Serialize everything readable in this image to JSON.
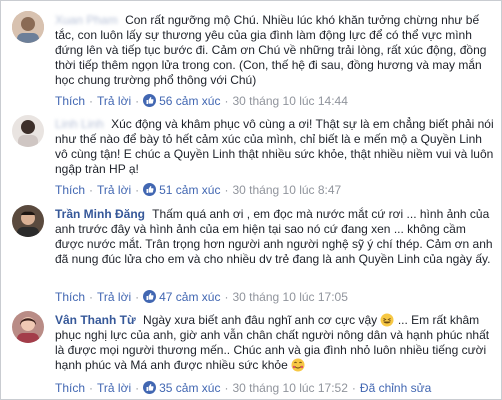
{
  "comments": [
    {
      "author": "Xuan Pham",
      "author_blurred": true,
      "text": "Con rất ngưỡng mộ Chú. Nhiều lúc khó khăn tưởng chừng như bế tắc, con luôn lấy sự thương yêu của gia đình làm động lực để có thể vực mình đứng lên và tiếp tục bước đi. Cảm ơn Chú về những trải lòng, rất xúc động, đồng thời tiếp thêm ngọn lửa trong con. (Con, thế hệ đi sau, đồng hương và may mắn học chung trường phổ thông với Chú)",
      "like_label": "Thích",
      "reply_label": "Trả lời",
      "reactions": "56 cảm xúc",
      "timestamp": "30 tháng 10 lúc 14:44",
      "edited_label": ""
    },
    {
      "author": "Linh Linh",
      "author_blurred": true,
      "text": "Xúc động và khâm phục vô cùng a ơi! Thật sự là em chẳng biết phải nói như thế nào để bày tỏ hết cảm xúc của mình, chỉ biết là e mến mộ a Quyền Linh vô cùng tận! E chúc a Quyền Linh thật nhiều sức khỏe, thật nhiều niềm vui và luôn ngập tràn HP ạ!",
      "like_label": "Thích",
      "reply_label": "Trả lời",
      "reactions": "51 cảm xúc",
      "timestamp": "30 tháng 10 lúc 8:47",
      "edited_label": ""
    },
    {
      "author": "Trần Minh Đăng",
      "author_blurred": false,
      "text": "Thấm quá anh ơi , em đọc mà nước mắt cứ rơi ... hình ảnh của anh trước đây và hình ảnh của em hiện tại sao nó cứ đang xen ... không cầm được nước mắt. Trân trọng hơn người anh người nghệ sỹ ý chí thép. Cảm ơn anh đã nung đúc lửa cho em và cho nhiều dv trẻ đang là anh Quyền Linh của ngày ấy.",
      "like_label": "Thích",
      "reply_label": "Trả lời",
      "reactions": "47 cảm xúc",
      "timestamp": "30 tháng 10 lúc 17:05",
      "edited_label": ""
    },
    {
      "author": "Vân Thanh Từ",
      "author_blurred": false,
      "text_a": "Ngày xưa biết anh đâu nghĩ anh cơ cực vậy",
      "text_b": "... Em rất khâm phục nghị lực của anh, giờ anh vẫn chân chất người nông dân và hạnh phúc nhất là được mọi người thương mến.. Chúc anh và gia đình nhỏ luôn nhiều tiếng cười hạnh phúc và Má anh được nhiều sức khỏe",
      "emoji_a": "laughing-face",
      "emoji_b": "smiling-face-hearts",
      "like_label": "Thích",
      "reply_label": "Trả lời",
      "reactions": "35 cảm xúc",
      "timestamp": "30 tháng 10 lúc 17:52",
      "edited_label": "Đã chỉnh sửa"
    }
  ],
  "colors": {
    "link": "#365899",
    "action": "#4267b2",
    "meta": "#90949c",
    "text": "#1d2129"
  }
}
